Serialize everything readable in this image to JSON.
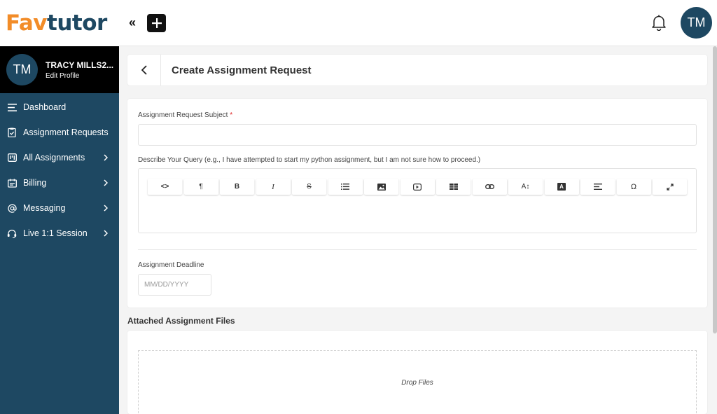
{
  "brand": {
    "logo_part1": "Fa",
    "logo_part2": "v",
    "logo_part3": "tutor",
    "orange": "#f28c28",
    "navy": "#1e4862"
  },
  "profile": {
    "initials": "TM",
    "name": "TRACY MILLS2...",
    "edit_label": "Edit Profile"
  },
  "sidebar": {
    "items": [
      {
        "label": "Dashboard",
        "icon": "hamburger-icon",
        "has_chevron": false
      },
      {
        "label": "Assignment Requests",
        "icon": "clipboard-check-icon",
        "has_chevron": false
      },
      {
        "label": "All Assignments",
        "icon": "kanban-icon",
        "has_chevron": true
      },
      {
        "label": "Billing",
        "icon": "receipt-icon",
        "has_chevron": true
      },
      {
        "label": "Messaging",
        "icon": "at-sign-icon",
        "has_chevron": true
      },
      {
        "label": "Live 1:1 Session",
        "icon": "headset-icon",
        "has_chevron": true
      }
    ]
  },
  "topbar": {
    "collapse_label": "«",
    "user_initials": "TM"
  },
  "header": {
    "title": "Create Assignment Request"
  },
  "form": {
    "subject_label": "Assignment Request Subject",
    "required_mark": "*",
    "query_label": "Describe Your Query (e.g., I have attempted to start my python assignment, but I am not sure how to proceed.)",
    "toolbar": [
      {
        "name": "code-view",
        "glyph": "<>"
      },
      {
        "name": "paragraph",
        "glyph": "¶"
      },
      {
        "name": "bold",
        "glyph": "B"
      },
      {
        "name": "italic",
        "glyph": "I"
      },
      {
        "name": "strikethrough",
        "glyph": "S"
      },
      {
        "name": "bullet-list",
        "glyph": ""
      },
      {
        "name": "image",
        "glyph": ""
      },
      {
        "name": "video",
        "glyph": ""
      },
      {
        "name": "table",
        "glyph": ""
      },
      {
        "name": "link",
        "glyph": ""
      },
      {
        "name": "font-size",
        "glyph": "A↕"
      },
      {
        "name": "text-color",
        "glyph": "A"
      },
      {
        "name": "align",
        "glyph": ""
      },
      {
        "name": "special-char",
        "glyph": "Ω"
      },
      {
        "name": "fullscreen",
        "glyph": ""
      }
    ],
    "deadline_label": "Assignment Deadline",
    "deadline_placeholder": "MM/DD/YYYY"
  },
  "files": {
    "heading": "Attached Assignment Files",
    "drop_label": "Drop Files"
  }
}
